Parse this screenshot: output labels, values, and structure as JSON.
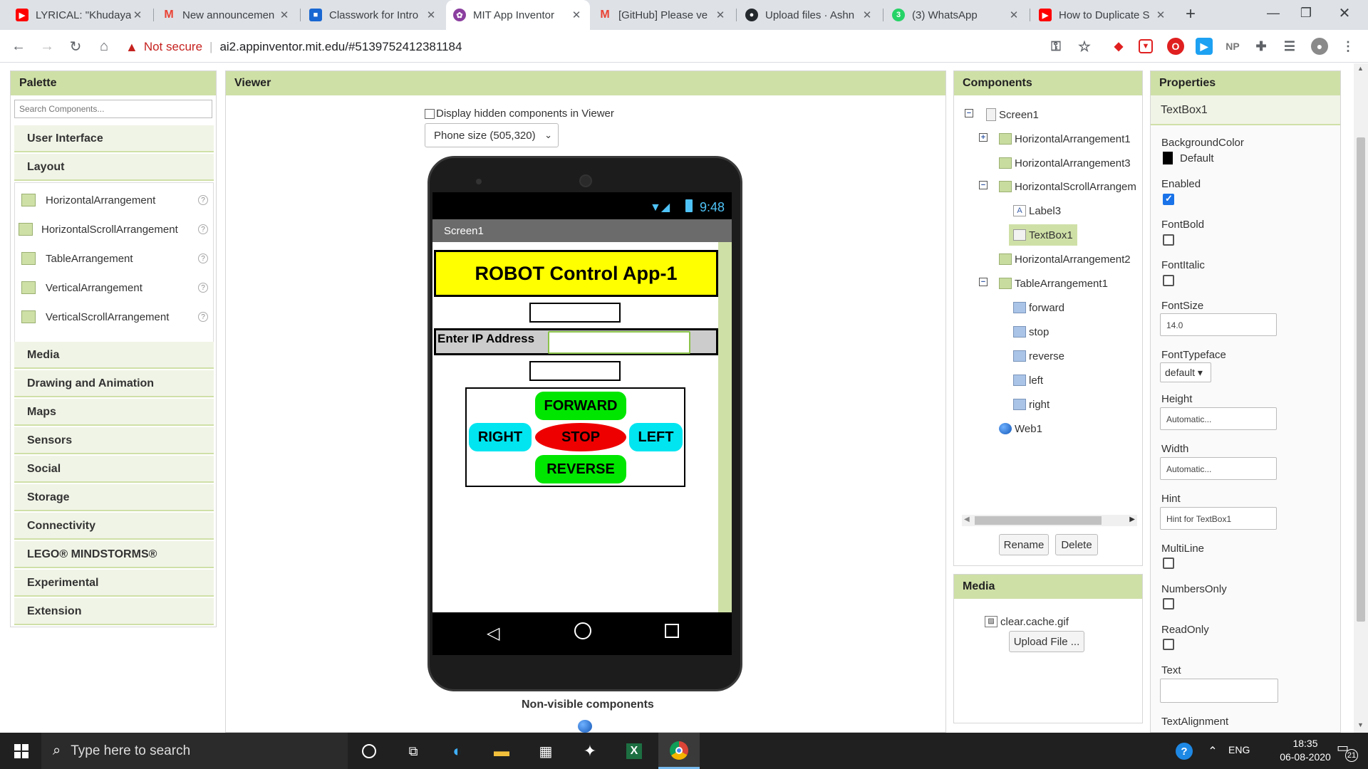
{
  "browser": {
    "tabs": [
      {
        "title": "LYRICAL: \"Khudaya",
        "fav_color": "#ff0000",
        "fav_glyph": "▶"
      },
      {
        "title": "New announcemen",
        "fav_color": "#ffffff",
        "fav_glyph": "M"
      },
      {
        "title": "Classwork for Intro",
        "fav_color": "#1967d2",
        "fav_glyph": "■"
      },
      {
        "title": "MIT App Inventor",
        "fav_color": "#8b3f9f",
        "fav_glyph": "✿"
      },
      {
        "title": "[GitHub] Please ve",
        "fav_color": "#ffffff",
        "fav_glyph": "M"
      },
      {
        "title": "Upload files · Ashn",
        "fav_color": "#24292e",
        "fav_glyph": "●"
      },
      {
        "title": "(3) WhatsApp",
        "fav_color": "#25d366",
        "fav_glyph": "3"
      },
      {
        "title": "How to Duplicate S",
        "fav_color": "#ff0000",
        "fav_glyph": "▶"
      }
    ],
    "tab_close": "✕",
    "new_tab": "+",
    "not_secure": "Not secure",
    "url": "ai2.appinventor.mit.edu/#5139752412381184",
    "ext_np": "NP"
  },
  "palette": {
    "title": "Palette",
    "search_placeholder": "Search Components...",
    "categories": [
      "User Interface",
      "Layout",
      "Media",
      "Drawing and Animation",
      "Maps",
      "Sensors",
      "Social",
      "Storage",
      "Connectivity",
      "LEGO® MINDSTORMS®",
      "Experimental",
      "Extension"
    ],
    "layout_items": [
      "HorizontalArrangement",
      "HorizontalScrollArrangement",
      "TableArrangement",
      "VerticalArrangement",
      "VerticalScrollArrangement"
    ],
    "help": "?"
  },
  "viewer": {
    "title": "Viewer",
    "hidden_checkbox_label": "Display hidden components in Viewer",
    "phone_size": "Phone size (505,320)",
    "status_time": "9:48",
    "screen_title": "Screen1",
    "app_title": "ROBOT Control App-1",
    "ip_label": "Enter IP Address",
    "btn_forward": "FORWARD",
    "btn_right": "RIGHT",
    "btn_stop": "STOP",
    "btn_left": "LEFT",
    "btn_reverse": "REVERSE",
    "nonvisible": "Non-visible components"
  },
  "components": {
    "title": "Components",
    "tree": [
      "Screen1",
      "HorizontalArrangement1",
      "HorizontalArrangement3",
      "HorizontalScrollArrangem",
      "Label3",
      "TextBox1",
      "HorizontalArrangement2",
      "TableArrangement1",
      "forward",
      "stop",
      "reverse",
      "left",
      "right",
      "Web1"
    ],
    "rename": "Rename",
    "delete": "Delete"
  },
  "media": {
    "title": "Media",
    "file": "clear.cache.gif",
    "upload": "Upload File ..."
  },
  "properties": {
    "title": "Properties",
    "component": "TextBox1",
    "background_color_label": "BackgroundColor",
    "background_color_value": "Default",
    "enabled_label": "Enabled",
    "fontbold_label": "FontBold",
    "fontitalic_label": "FontItalic",
    "fontsize_label": "FontSize",
    "fontsize_value": "14.0",
    "fonttypeface_label": "FontTypeface",
    "fonttypeface_value": "default ▾",
    "height_label": "Height",
    "height_value": "Automatic...",
    "width_label": "Width",
    "width_value": "Automatic...",
    "hint_label": "Hint",
    "hint_value": "Hint for TextBox1",
    "multiline_label": "MultiLine",
    "numbersonly_label": "NumbersOnly",
    "readonly_label": "ReadOnly",
    "text_label": "Text",
    "textalignment_label": "TextAlignment"
  },
  "taskbar": {
    "search": "Type here to search",
    "lang": "ENG",
    "time": "18:35",
    "date": "06-08-2020",
    "notif": "21"
  },
  "colors": {
    "panel_header": "#cfe0a7",
    "title_bar": "#ffff00",
    "go_green": "#00e600",
    "side_cyan": "#00e5f0",
    "stop_red": "#ee0000"
  }
}
